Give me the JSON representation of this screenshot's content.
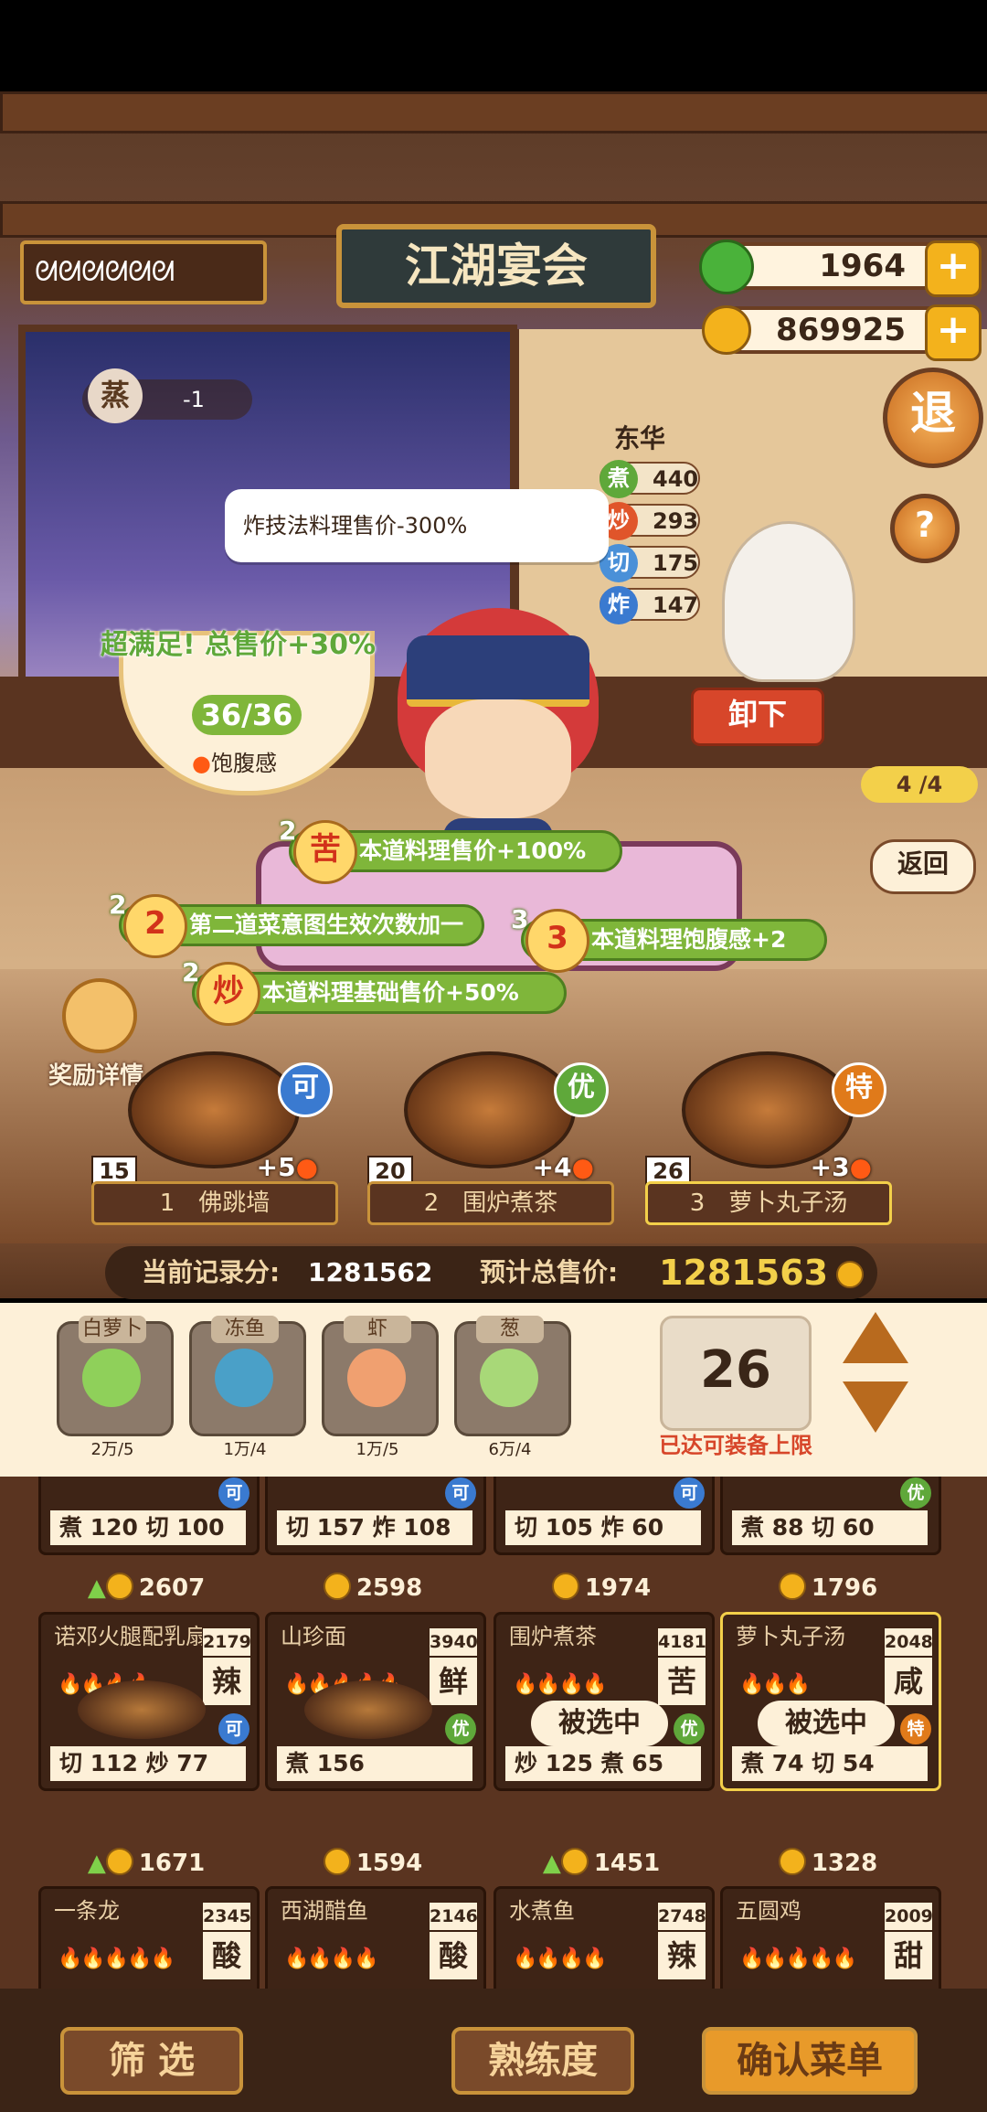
{
  "header": {
    "player_name": "ᘛᘛᘛᘛᘛᘛ",
    "title_sign": "江湖宴会",
    "gems": "1964",
    "coins": "869925",
    "exit_label": "退",
    "help_label": "?"
  },
  "steam_badge": {
    "label": "蒸",
    "value": "-1"
  },
  "chef": {
    "name": "东华",
    "stats": [
      {
        "icon": "煮",
        "value": "440",
        "color": "#5fa83a"
      },
      {
        "icon": "炒",
        "value": "293",
        "color": "#e0552a"
      },
      {
        "icon": "切",
        "value": "175",
        "color": "#4a90d8"
      },
      {
        "icon": "炸",
        "value": "147",
        "color": "#3a7ad0"
      }
    ],
    "unload_label": "卸下"
  },
  "tooltip": "炸技法料理售价-300%",
  "satisfaction": {
    "text": "超满足! 总售价+30%",
    "value": "36/36",
    "label": "饱腹感"
  },
  "right_panel": {
    "progress": "4 /4",
    "back_label": "返回"
  },
  "buffs": [
    {
      "count": "2",
      "icon": "苦",
      "text": "本道料理售价+100%"
    },
    {
      "count": "2",
      "icon": "2",
      "text": "第二道菜意图生效次数加一"
    },
    {
      "count": "3",
      "icon": "3",
      "text": "本道料理饱腹感+2"
    },
    {
      "count": "2",
      "icon": "炒",
      "text": "本道料理基础售价+50%"
    }
  ],
  "reward_details": "奖励详情",
  "selected_dishes": [
    {
      "index": "1",
      "name": "佛跳墙",
      "qty": "15",
      "bonus": "+5",
      "grade": "可",
      "grade_color": "#3a7ad0"
    },
    {
      "index": "2",
      "name": "围炉煮茶",
      "qty": "20",
      "bonus": "+4",
      "grade": "优",
      "grade_color": "#5fa83a"
    },
    {
      "index": "3",
      "name": "萝卜丸子汤",
      "qty": "26",
      "bonus": "+3",
      "grade": "特",
      "grade_color": "#e07a1a"
    }
  ],
  "scores": {
    "record_label": "当前记录分:",
    "record_value": "1281562",
    "total_label": "预计总售价:",
    "total_value": "1281563"
  },
  "ingredients": [
    {
      "name": "白萝卜",
      "qty": "2万/5",
      "glyph": "radish-icon"
    },
    {
      "name": "冻鱼",
      "qty": "1万/4",
      "glyph": "fish-icon"
    },
    {
      "name": "虾",
      "qty": "1万/5",
      "glyph": "shrimp-icon"
    },
    {
      "name": "葱",
      "qty": "6万/4",
      "glyph": "scallion-icon"
    }
  ],
  "quantity": {
    "value": "26",
    "limit_text": "已达可装备上限"
  },
  "grid_row1": [
    {
      "stat": "煮 120  切 100",
      "price": "2607",
      "grade": "可",
      "up": true
    },
    {
      "stat": "切 157  炸 108",
      "price": "2598",
      "grade": "可",
      "up": false
    },
    {
      "stat": "切 105  炸 60",
      "price": "1974",
      "grade": "可",
      "up": false
    },
    {
      "stat": "煮 88   切 60",
      "price": "1796",
      "grade": "优",
      "up": false
    }
  ],
  "grid_row2": [
    {
      "title": "诺邓火腿配乳扇",
      "pts": "2179",
      "taste": "辣",
      "fire": "🔥🔥🔥🔥",
      "stat": "切 112  炒 77",
      "price": "1671",
      "grade": "可",
      "up": true,
      "selected": ""
    },
    {
      "title": "山珍面",
      "pts": "3940",
      "taste": "鲜",
      "fire": "🔥🔥🔥🔥🔥",
      "stat": "煮 156",
      "price": "1594",
      "grade": "优",
      "up": false,
      "selected": ""
    },
    {
      "title": "围炉煮茶",
      "pts": "4181",
      "taste": "苦",
      "fire": "🔥🔥🔥🔥",
      "stat": "炒 125  煮 65",
      "price": "1451",
      "grade": "优",
      "up": true,
      "selected": "被选中"
    },
    {
      "title": "萝卜丸子汤",
      "pts": "2048",
      "taste": "咸",
      "fire": "🔥🔥🔥",
      "stat": "煮 74   切 54",
      "price": "1328",
      "grade": "特",
      "up": false,
      "selected": "被选中"
    }
  ],
  "grid_row3": [
    {
      "title": "一条龙",
      "pts": "2345",
      "taste": "酸",
      "fire": "🔥🔥🔥🔥🔥"
    },
    {
      "title": "西湖醋鱼",
      "pts": "2146",
      "taste": "酸",
      "fire": "🔥🔥🔥🔥"
    },
    {
      "title": "水煮鱼",
      "pts": "2748",
      "taste": "辣",
      "fire": "🔥🔥🔥🔥"
    },
    {
      "title": "五圆鸡",
      "pts": "2009",
      "taste": "甜",
      "fire": "🔥🔥🔥🔥🔥"
    }
  ],
  "bottom": {
    "filter": "筛 选",
    "proficiency": "熟练度",
    "confirm": "确认菜单"
  }
}
